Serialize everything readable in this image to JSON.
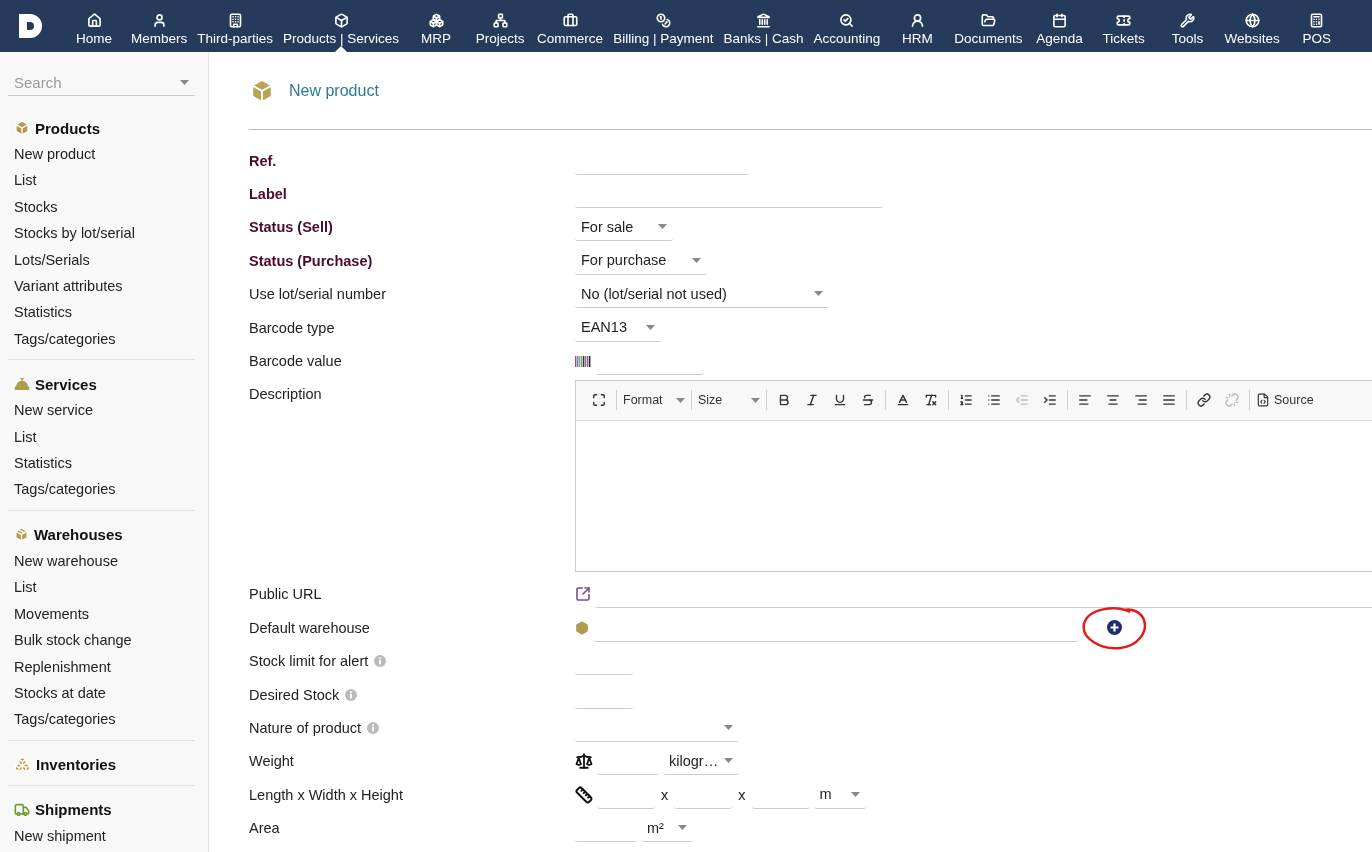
{
  "nav": [
    {
      "label": "Home",
      "selected": false
    },
    {
      "label": "Members",
      "selected": false
    },
    {
      "label": "Third-parties",
      "selected": false
    },
    {
      "label": "Products | Services",
      "selected": true
    },
    {
      "label": "MRP",
      "selected": false
    },
    {
      "label": "Projects",
      "selected": false
    },
    {
      "label": "Commerce",
      "selected": false
    },
    {
      "label": "Billing | Payment",
      "selected": false
    },
    {
      "label": "Banks | Cash",
      "selected": false
    },
    {
      "label": "Accounting",
      "selected": false
    },
    {
      "label": "HRM",
      "selected": false
    },
    {
      "label": "Documents",
      "selected": false
    },
    {
      "label": "Agenda",
      "selected": false
    },
    {
      "label": "Tickets",
      "selected": false
    },
    {
      "label": "Tools",
      "selected": false
    },
    {
      "label": "Websites",
      "selected": false
    },
    {
      "label": "POS",
      "selected": false
    }
  ],
  "sidebar": {
    "search": {
      "placeholder": "Search"
    },
    "sections": [
      {
        "kind": "products",
        "title": "Products",
        "items": [
          "New product",
          "List",
          "Stocks",
          "Stocks by lot/serial",
          "Lots/Serials",
          "Variant attributes",
          "Statistics",
          "Tags/categories"
        ]
      },
      {
        "kind": "services",
        "title": "Services",
        "items": [
          "New service",
          "List",
          "Statistics",
          "Tags/categories"
        ]
      },
      {
        "kind": "warehouses",
        "title": "Warehouses",
        "items": [
          "New warehouse",
          "List",
          "Movements",
          "Bulk stock change",
          "Replenishment",
          "Stocks at date",
          "Tags/categories"
        ]
      },
      {
        "kind": "inventories",
        "title": "Inventories"
      },
      {
        "kind": "shipments",
        "title": "Shipments",
        "items": [
          "New shipment"
        ]
      }
    ]
  },
  "page": {
    "title": "New product"
  },
  "form": [
    {
      "label": "Ref.",
      "required": true,
      "controls": [
        {
          "kind": "input"
        }
      ]
    },
    {
      "label": "Label",
      "required": true,
      "controls": [
        {
          "kind": "input"
        }
      ]
    },
    {
      "label": "Status (Sell)",
      "required": true,
      "controls": [
        {
          "kind": "select",
          "value": "For sale"
        }
      ]
    },
    {
      "label": "Status (Purchase)",
      "required": true,
      "controls": [
        {
          "kind": "select",
          "value": "For purchase"
        }
      ]
    },
    {
      "label": "Use lot/serial number",
      "required": false,
      "controls": [
        {
          "kind": "select",
          "value": "No (lot/serial not used)"
        }
      ]
    },
    {
      "label": "Barcode type",
      "required": false,
      "controls": [
        {
          "kind": "select",
          "value": "EAN13"
        }
      ]
    },
    {
      "label": "Barcode value",
      "required": false,
      "controls": [
        {
          "kind": "barcode"
        },
        {
          "kind": "input"
        }
      ]
    },
    {
      "label": "Description",
      "required": false,
      "controls": [
        {
          "kind": "editor",
          "format": "Format",
          "size_label": "Size",
          "source": "Source",
          "tools": [
            {
              "kind": "maximize",
              "disabled": false
            },
            {
              "kind": "format",
              "disabled": false
            },
            {
              "kind": "size",
              "disabled": false
            },
            {
              "kind": "bold",
              "disabled": false
            },
            {
              "kind": "italic",
              "disabled": false
            },
            {
              "kind": "underline",
              "disabled": false
            },
            {
              "kind": "strike",
              "disabled": false
            },
            {
              "kind": "color",
              "disabled": false
            },
            {
              "kind": "clear",
              "disabled": false
            },
            {
              "kind": "numbered",
              "disabled": false
            },
            {
              "kind": "bulleted",
              "disabled": false
            },
            {
              "kind": "outdent",
              "disabled": true
            },
            {
              "kind": "indent",
              "disabled": false
            },
            {
              "kind": "left",
              "disabled": false
            },
            {
              "kind": "center",
              "disabled": false
            },
            {
              "kind": "right",
              "disabled": false
            },
            {
              "kind": "justify",
              "disabled": false
            },
            {
              "kind": "link",
              "disabled": false
            },
            {
              "kind": "unlink",
              "disabled": true
            },
            {
              "kind": "source",
              "disabled": false
            }
          ]
        }
      ]
    },
    {
      "label": "Public URL",
      "required": false,
      "controls": [
        {
          "kind": "link"
        },
        {
          "kind": "input"
        }
      ]
    },
    {
      "label": "Default warehouse",
      "required": false,
      "controls": [
        {
          "kind": "warehouse"
        },
        {
          "kind": "input"
        },
        {
          "kind": "add",
          "highlighted": true
        }
      ]
    },
    {
      "label": "Stock limit for alert",
      "required": false,
      "info": true,
      "controls": [
        {
          "kind": "input"
        }
      ]
    },
    {
      "label": "Desired Stock",
      "required": false,
      "info": true,
      "controls": [
        {
          "kind": "input"
        }
      ]
    },
    {
      "label": "Nature of product",
      "required": false,
      "info": true,
      "controls": [
        {
          "kind": "select"
        }
      ]
    },
    {
      "label": "Weight",
      "required": false,
      "controls": [
        {
          "kind": "scale"
        },
        {
          "kind": "input"
        },
        {
          "kind": "select",
          "value": "kilogr…"
        }
      ]
    },
    {
      "label": "Length x Width x Height",
      "required": false,
      "controls": [
        {
          "kind": "ruler"
        },
        {
          "kind": "input"
        },
        {
          "kind": "sep",
          "text": "x"
        },
        {
          "kind": "input"
        },
        {
          "kind": "sep",
          "text": "x"
        },
        {
          "kind": "input"
        },
        {
          "kind": "select",
          "value": "m"
        }
      ]
    },
    {
      "label": "Area",
      "required": false,
      "controls": [
        {
          "kind": "input"
        },
        {
          "kind": "select",
          "value": "m²"
        }
      ]
    }
  ]
}
